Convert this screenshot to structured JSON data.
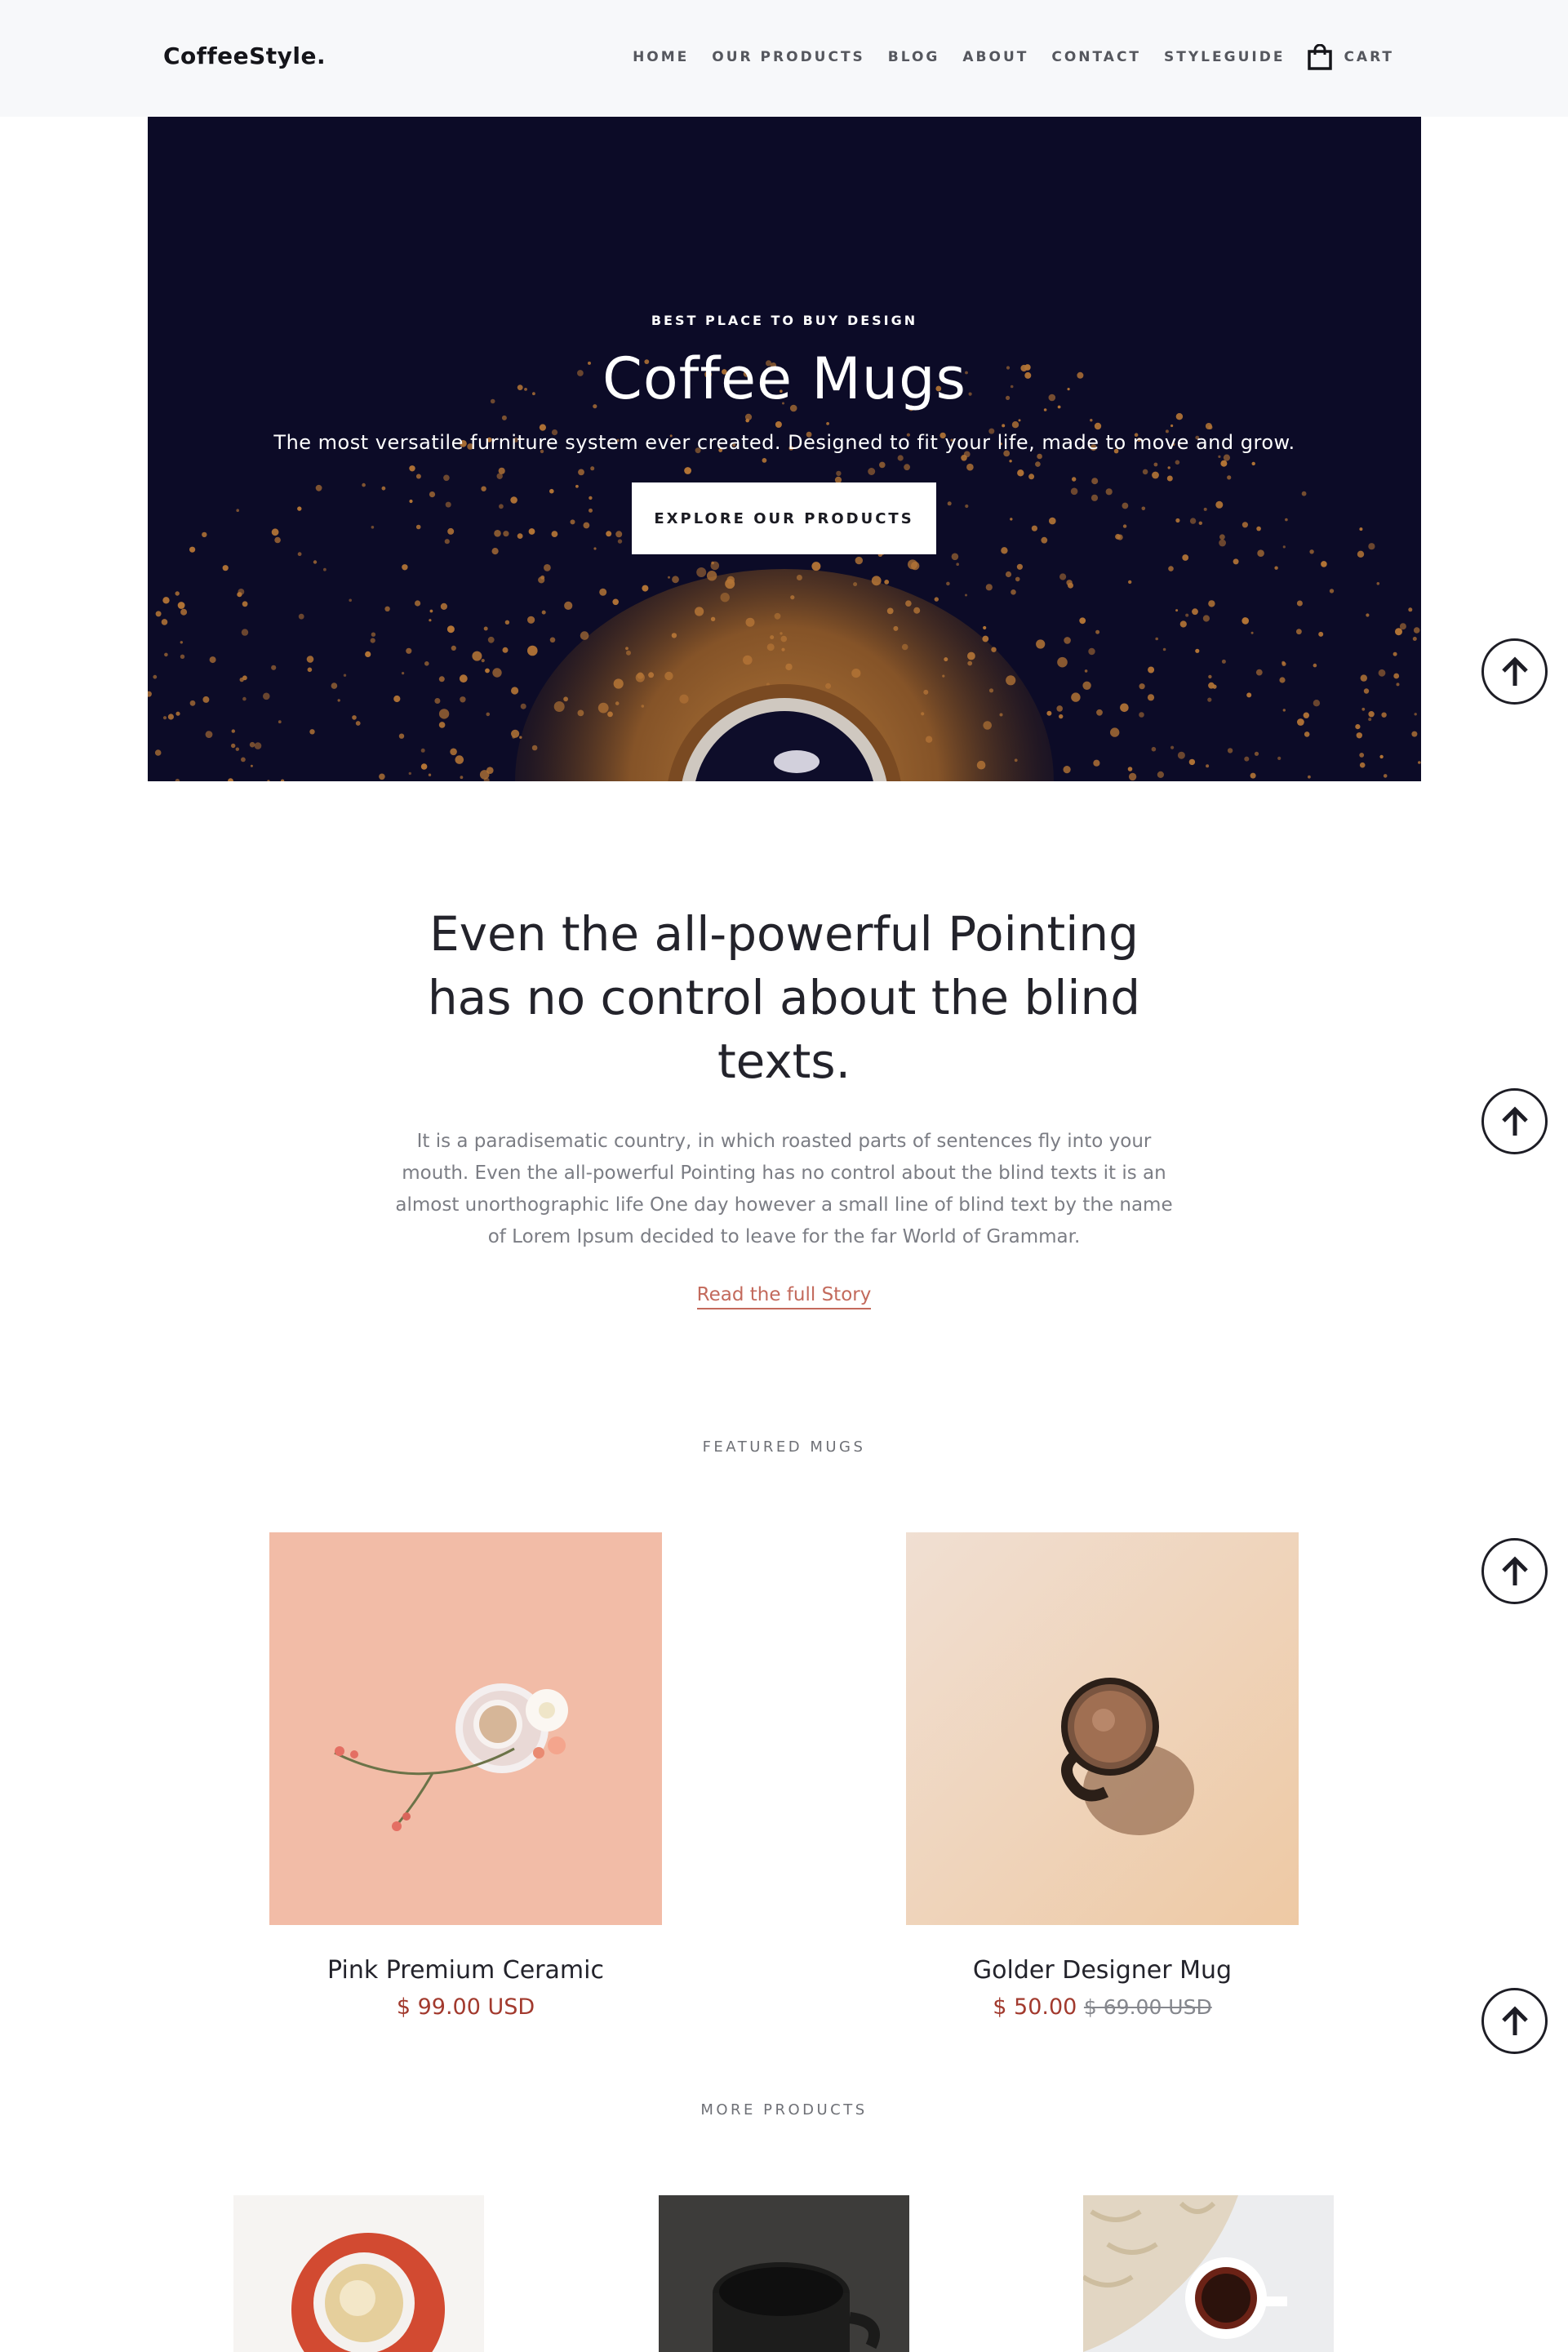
{
  "header": {
    "logo": "CoffeeStyle.",
    "nav": [
      "HOME",
      "OUR PRODUCTS",
      "BLOG",
      "ABOUT",
      "CONTACT",
      "STYLEGUIDE"
    ],
    "cart_label": "CART",
    "cart_icon": "shopping-bag-icon"
  },
  "hero": {
    "kicker": "BEST PLACE TO BUY DESIGN",
    "title": "Coffee Mugs",
    "subtitle": "The most versatile furniture system ever created. Designed to fit your life, made to move and grow.",
    "button": "EXPLORE OUR PRODUCTS",
    "background_color": "#0c0b27"
  },
  "intro": {
    "heading": "Even the all-powerful Pointing has no control about the blind texts.",
    "body": "It is a paradisematic country, in which roasted parts of sentences fly into your mouth. Even the all-powerful Pointing has no control about the blind texts it is an almost unorthographic life One day however a small line of blind text by the name of Lorem Ipsum decided to leave for the far World of Grammar.",
    "link": "Read the full Story"
  },
  "featured": {
    "label": "FEATURED MUGS",
    "items": [
      {
        "name": "Pink Premium Ceramic",
        "price": "$ 99.00 USD",
        "old_price": ""
      },
      {
        "name": "Golder Designer Mug",
        "price": "$ 50.00",
        "old_price": "$ 69.00 USD"
      }
    ]
  },
  "more": {
    "label": "MORE PRODUCTS"
  },
  "scroll_up_icon": "arrow-up-circle-icon",
  "colors": {
    "accent": "#c36a5c",
    "price": "#a23a2e",
    "dark": "#0c0b27"
  }
}
